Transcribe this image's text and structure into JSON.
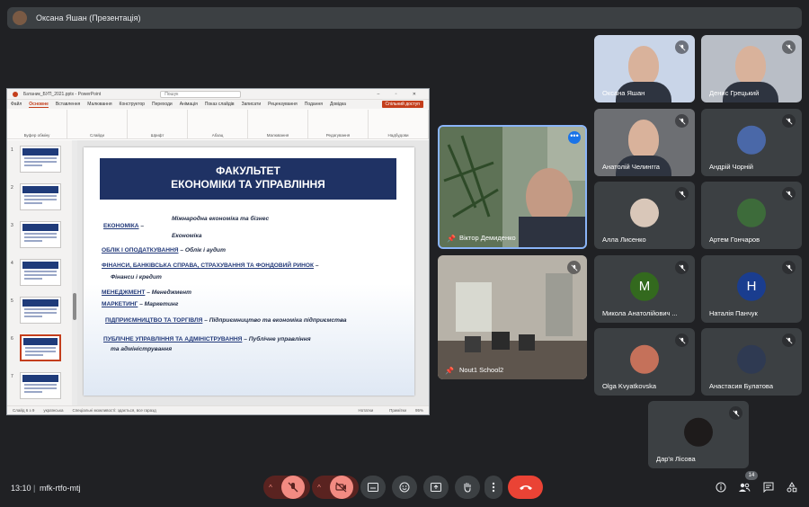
{
  "presenter_bar": {
    "label": "Оксана Яшан (Презентація)"
  },
  "powerpoint": {
    "title": "Батаник_БУП_2021.pptx - PowerPoint",
    "search_placeholder": "Пошук",
    "tabs": [
      "Файл",
      "Основне",
      "Вставлення",
      "Малювання",
      "Конструктор",
      "Переходи",
      "Анімація",
      "Показ слайдів",
      "Записати",
      "Рецензування",
      "Подання",
      "Довідка"
    ],
    "active_tab": "Основне",
    "share_label": "Спільний доступ",
    "ribbon_groups": [
      "Буфер обміну",
      "Слайди",
      "Шрифт",
      "Абзац",
      "Малювання",
      "Редагування",
      "Надбудови"
    ],
    "ribbon_buttons": {
      "create_slide": "Створити слайд",
      "shapes": "Фігури",
      "arrange": "Упорядкувати",
      "styles": "Стилі",
      "editing": "Редагування",
      "addins": "Надбудови"
    },
    "slide_numbers": [
      "1",
      "2",
      "3",
      "4",
      "5",
      "6",
      "7"
    ],
    "selected_slide": 6,
    "status": {
      "slide_count": "Слайд 6 з 9",
      "language": "українська",
      "accessibility": "Спеціальні можливості: здається, все гаразд",
      "notes": "Нотатки",
      "comments": "Примітки",
      "zoom": "95%"
    },
    "slide": {
      "heading_line1": "ФАКУЛЬТЕТ",
      "heading_line2": "ЕКОНОМІКИ ТА УПРАВЛІННЯ",
      "items": [
        {
          "head": "",
          "text": "Міжнародна економіка та бізнес"
        },
        {
          "head": "ЕКОНОМІКА",
          "text": "–"
        },
        {
          "head": "",
          "text": "Економіка"
        },
        {
          "head": "ОБЛІК І ОПОДАТКУВАННЯ",
          "text": "– Облік і аудит"
        },
        {
          "head": "ФІНАНСИ, БАНКІВСЬКА СПРАВА, СТРАХУВАННЯ ТА ФОНДОВИЙ РИНОК",
          "text": "–"
        },
        {
          "head": "",
          "text": "Фінанси і кредит"
        },
        {
          "head": "МЕНЕДЖМЕНТ",
          "text": "– Менеджмент"
        },
        {
          "head": "МАРКЕТИНГ",
          "text": "– Маркетинг"
        },
        {
          "head": "ПІДПРИЄМНИЦТВО ТА ТОРГІВЛЯ",
          "text": "– Підприємництво та економіка підприємства"
        },
        {
          "head": "ПУБЛІЧНЕ УПРАВЛІННЯ ТА АДМІНІСТРУВАННЯ",
          "text": "– Публічне управління"
        },
        {
          "head": "",
          "text": "та адміністрування"
        }
      ]
    }
  },
  "large_tiles": [
    {
      "name": "Віктор Демиденко",
      "pinned": true
    },
    {
      "name": "Nout1 School2",
      "pinned": true
    }
  ],
  "participants": [
    {
      "name": "Оксана Яшан",
      "muted": true,
      "kind": "video",
      "color": "#c9d5e8"
    },
    {
      "name": "Денис Грецький",
      "muted": true,
      "kind": "video",
      "color": "#b9bec6"
    },
    {
      "name": "Анатолій Челингга",
      "muted": true,
      "kind": "video",
      "color": "#6d6f73"
    },
    {
      "name": "Андрій Чорній",
      "muted": true,
      "kind": "photo",
      "color": "#4a68a8"
    },
    {
      "name": "Алла Лисенко",
      "muted": true,
      "kind": "photo",
      "color": "#d9c7b9"
    },
    {
      "name": "Артем Гончаров",
      "muted": true,
      "kind": "photo",
      "color": "#3d6b3a"
    },
    {
      "name": "Микола Анатолійович ...",
      "muted": true,
      "kind": "letter",
      "letter": "M",
      "color": "#33691e"
    },
    {
      "name": "Наталія Панчук",
      "muted": true,
      "kind": "letter",
      "letter": "Н",
      "color": "#1a3d8f"
    },
    {
      "name": "Olga Kvyatkovska",
      "muted": true,
      "kind": "photo",
      "color": "#c5715a"
    },
    {
      "name": "Анастасия Булатова",
      "muted": true,
      "kind": "photo",
      "color": "#2f3a52"
    },
    {
      "name": "Дар'я Лісова",
      "muted": true,
      "kind": "photo",
      "color": "#1e1b1b"
    }
  ],
  "bottom_bar": {
    "time": "13:10",
    "separator": "|",
    "meeting_code": "mfk-rtfo-mtj",
    "people_count": "14"
  }
}
